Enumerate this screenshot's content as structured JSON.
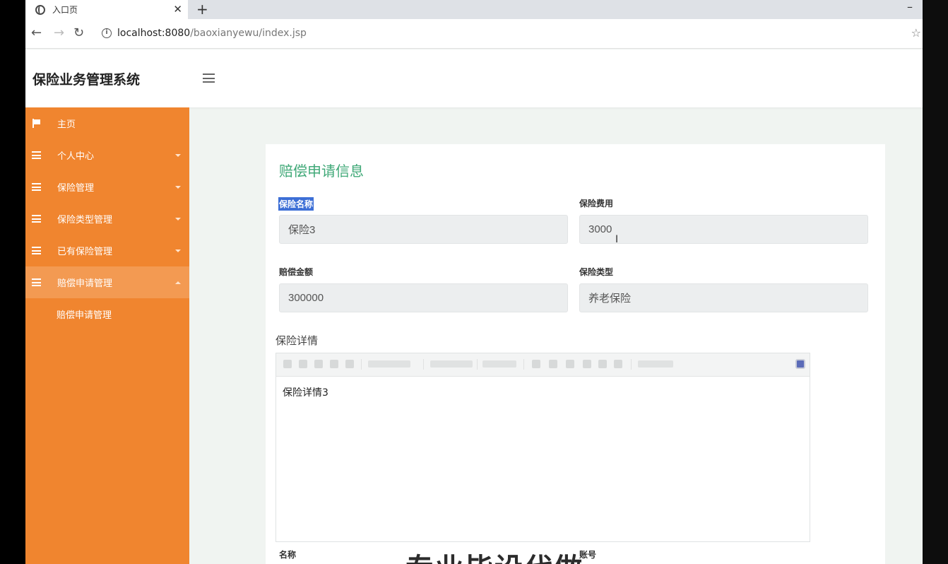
{
  "browser": {
    "tab_title": "入口页",
    "tab_close": "✕",
    "new_tab": "+",
    "minimize": "–",
    "url_host": "localhost:8080",
    "url_path": "/baoxianyewu/index.jsp",
    "back": "←",
    "forward": "→",
    "reload": "↻",
    "info": "i",
    "star": "☆"
  },
  "header": {
    "title": "保险业务管理系统"
  },
  "sidebar": {
    "items": [
      {
        "label": "主页",
        "icon": "flag-icon",
        "expanded": false
      },
      {
        "label": "个人中心",
        "icon": "list-icon",
        "expanded": false
      },
      {
        "label": "保险管理",
        "icon": "list-icon",
        "expanded": false
      },
      {
        "label": "保险类型管理",
        "icon": "list-icon",
        "expanded": false
      },
      {
        "label": "已有保险管理",
        "icon": "list-icon",
        "expanded": false
      },
      {
        "label": "赔偿申请管理",
        "icon": "list-icon",
        "expanded": true
      }
    ],
    "subitem": "赔偿申请管理",
    "colors": {
      "background": "#f0852f",
      "active": "#f39a52"
    }
  },
  "card": {
    "title": "赔偿申请信息",
    "fields": {
      "insurance_name": {
        "label": "保险名称",
        "value": "保险3"
      },
      "insurance_fee": {
        "label": "保险费用",
        "value": "3000"
      },
      "compensation_amount": {
        "label": "赔偿金额",
        "value": "300000"
      },
      "insurance_type": {
        "label": "保险类型",
        "value": "养老保险"
      }
    },
    "detail_label": "保险详情",
    "editor_content": "保险详情3",
    "bottom_labels": {
      "left": "名称",
      "right": "账号"
    },
    "watermark": "专业毕设代做",
    "accent_color": "#3fa877"
  }
}
